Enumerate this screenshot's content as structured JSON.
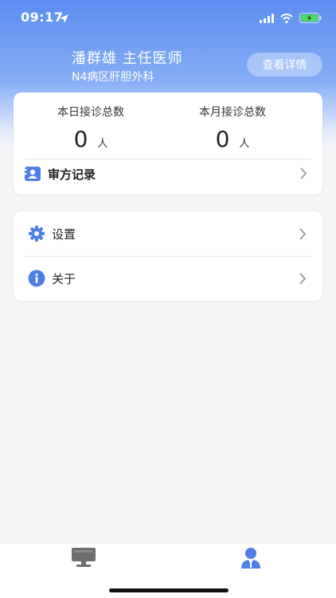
{
  "status_bar": {
    "time": "09:17",
    "location_icon": "location-arrow-icon",
    "signal_icon": "cell-signal-icon",
    "wifi_icon": "wifi-icon",
    "battery_icon": "battery-charging-icon"
  },
  "header": {
    "doctor_name": "潘群雄  主任医师",
    "department": "N4病区肝胆外科",
    "details_button": "查看详情"
  },
  "stats": {
    "today_label": "本日接诊总数",
    "today_value": "0",
    "today_unit": "人",
    "month_label": "本月接诊总数",
    "month_value": "0",
    "month_unit": "人"
  },
  "prescription_record": {
    "label": "审方记录",
    "icon": "contact-card-icon"
  },
  "menu": {
    "settings": {
      "label": "设置",
      "icon": "gear-icon"
    },
    "about": {
      "label": "关于",
      "icon": "info-icon"
    }
  },
  "tabbar": {
    "workbench_icon": "monitor-icon",
    "profile_icon": "doctor-profile-icon"
  },
  "colors": {
    "accent": "#4f7fe6",
    "header_top": "#5b8ef0",
    "tab_inactive": "#7a7a7a"
  }
}
